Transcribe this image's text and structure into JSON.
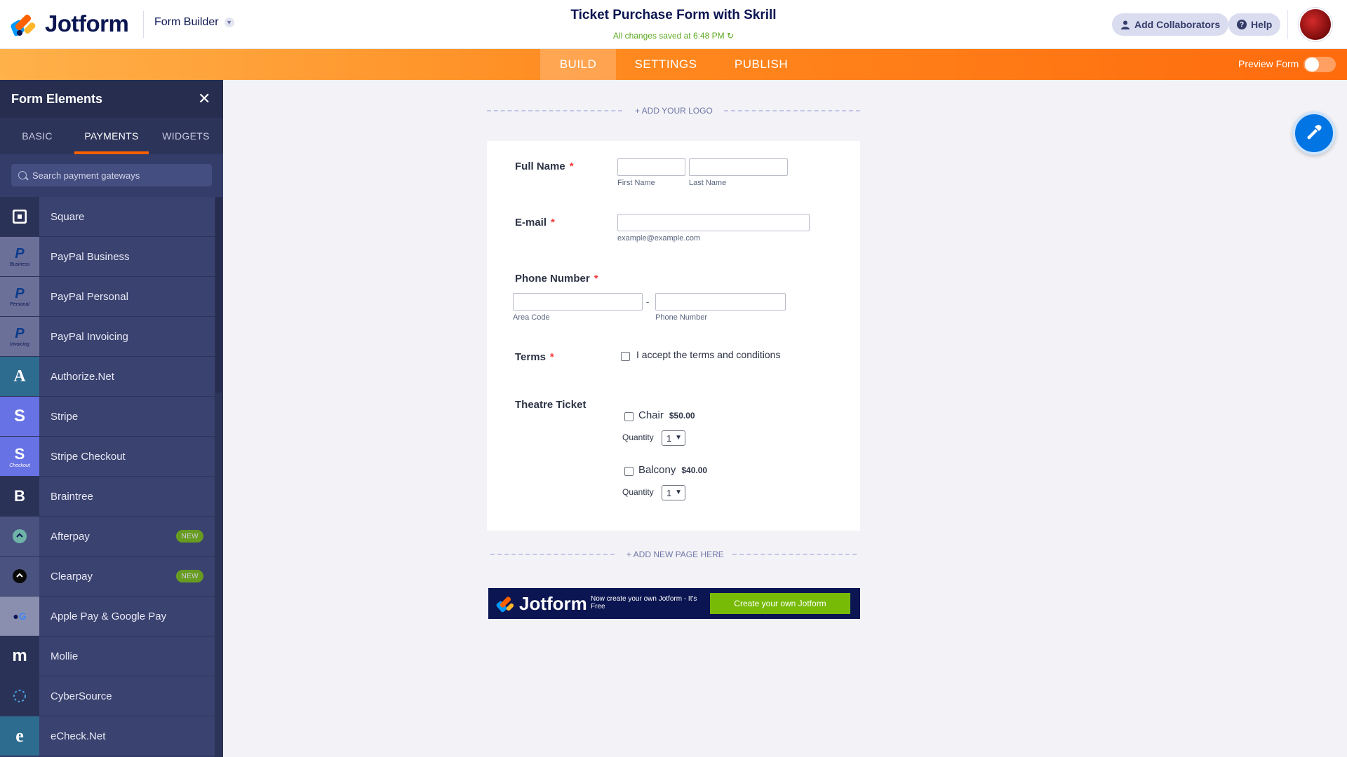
{
  "header": {
    "brand": "Jotform",
    "builder_menu": "Form Builder",
    "form_title": "Ticket Purchase Form with Skrill",
    "saved_status": "All changes saved at 6:48 PM",
    "add_collaborators": "Add Collaborators",
    "help": "Help"
  },
  "nav": {
    "tabs": [
      {
        "label": "BUILD",
        "active": true
      },
      {
        "label": "SETTINGS",
        "active": false
      },
      {
        "label": "PUBLISH",
        "active": false
      }
    ],
    "preview_label": "Preview Form",
    "preview_on": false
  },
  "sidebar": {
    "title": "Form Elements",
    "tabs": [
      {
        "label": "BASIC",
        "active": false
      },
      {
        "label": "PAYMENTS",
        "active": true
      },
      {
        "label": "WIDGETS",
        "active": false
      }
    ],
    "search_placeholder": "Search payment gateways",
    "items": [
      {
        "label": "Square",
        "icon": "square-icon",
        "color": "#3a4270",
        "badge": "",
        "sub": ""
      },
      {
        "label": "PayPal Business",
        "icon": "paypal-icon",
        "color": "#4a5280",
        "badge": "",
        "sub": "Business"
      },
      {
        "label": "PayPal Personal",
        "icon": "paypal-icon",
        "color": "#4a5280",
        "badge": "",
        "sub": "Personal"
      },
      {
        "label": "PayPal Invoicing",
        "icon": "paypal-icon",
        "color": "#4a5280",
        "badge": "",
        "sub": "Invoicing"
      },
      {
        "label": "Authorize.Net",
        "icon": "authorize-net-icon",
        "color": "#2d6b8f",
        "badge": "",
        "sub": ""
      },
      {
        "label": "Stripe",
        "icon": "stripe-icon",
        "color": "#6772e5",
        "badge": "",
        "sub": ""
      },
      {
        "label": "Stripe Checkout",
        "icon": "stripe-icon",
        "color": "#6772e5",
        "badge": "",
        "sub": "Checkout"
      },
      {
        "label": "Braintree",
        "icon": "braintree-icon",
        "color": "#2b3257",
        "badge": "",
        "sub": ""
      },
      {
        "label": "Afterpay",
        "icon": "afterpay-icon",
        "color": "#4a5280",
        "badge": "NEW",
        "sub": ""
      },
      {
        "label": "Clearpay",
        "icon": "clearpay-icon",
        "color": "#4a5280",
        "badge": "NEW",
        "sub": ""
      },
      {
        "label": "Apple Pay & Google Pay",
        "icon": "apple-google-pay-icon",
        "color": "#6b7099",
        "badge": "",
        "sub": ""
      },
      {
        "label": "Mollie",
        "icon": "mollie-icon",
        "color": "#2b3257",
        "badge": "",
        "sub": ""
      },
      {
        "label": "CyberSource",
        "icon": "cybersource-icon",
        "color": "#3a4270",
        "badge": "",
        "sub": ""
      },
      {
        "label": "eCheck.Net",
        "icon": "echeck-icon",
        "color": "#2d6b8f",
        "badge": "",
        "sub": ""
      }
    ]
  },
  "canvas": {
    "add_logo": "+ ADD YOUR LOGO",
    "add_page": "+ ADD NEW PAGE HERE",
    "fields": {
      "full_name": {
        "label": "Full Name",
        "first_sub": "First Name",
        "last_sub": "Last Name"
      },
      "email": {
        "label": "E-mail",
        "sub": "example@example.com"
      },
      "phone": {
        "label": "Phone Number",
        "dash": "-",
        "area_sub": "Area Code",
        "number_sub": "Phone Number"
      },
      "terms": {
        "label": "Terms",
        "option": "I accept the terms and conditions"
      },
      "ticket": {
        "label": "Theatre Ticket",
        "products": [
          {
            "name": "Chair",
            "price": "$50.00",
            "qty_label": "Quantity",
            "qty": "1"
          },
          {
            "name": "Balcony",
            "price": "$40.00",
            "qty_label": "Quantity",
            "qty": "1"
          }
        ]
      }
    },
    "required_mark": "*",
    "banner": {
      "brand": "Jotform",
      "text": "Now create your own Jotform - It's Free",
      "button": "Create your own Jotform"
    }
  },
  "colors": {
    "accent": "#ff6100",
    "sidebar_bg": "#343c6a",
    "fab": "#0075e3",
    "badge": "#78bb07"
  }
}
